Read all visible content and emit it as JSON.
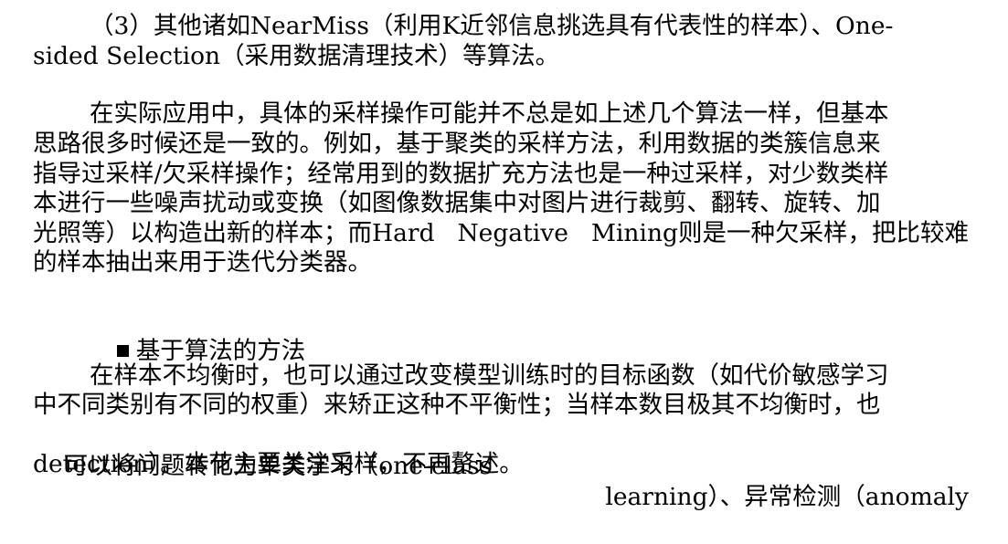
{
  "paragraph_1": {
    "line_1": "（3）其他诸如NearMiss（利用K近邻信息挑选具有代表性的样本）、One-",
    "line_2": "sided Selection（采用数据清理技术）等算法。"
  },
  "paragraph_2": {
    "line_1": "在实际应用中，具体的采样操作可能并不总是如上述几个算法一样，但基本",
    "line_2": "思路很多时候还是一致的。例如，基于聚类的采样方法，利用数据的类簇信息来",
    "line_3": "指导过采样/欠采样操作；经常用到的数据扩充方法也是一种过采样，对少数类样",
    "line_4": "本进行一些噪声扰动或变换（如图像数据集中对图片进行裁剪、翻转、旋转、加",
    "line_5_parts": [
      "光照等）以构造出新的样本；而Hard",
      "Negative",
      "Mining则是一种欠采样，把比较难"
    ],
    "line_6": "的样本抽出来用于迭代分类器。"
  },
  "heading": {
    "text": "基于算法的方法"
  },
  "paragraph_3": {
    "line_1": "在样本不均衡时，也可以通过改变模型训练时的目标函数（如代价敏感学习",
    "line_2": "中不同类别有不同的权重）来矫正这种不平衡性；当样本数目极其不均衡时，也",
    "line_3_parts": [
      "可以将问题转化为单类学习（one-class",
      "learning）、异常检测（anomaly"
    ],
    "line_4": "detection）。本节主要关注采样，不再赘述。"
  }
}
